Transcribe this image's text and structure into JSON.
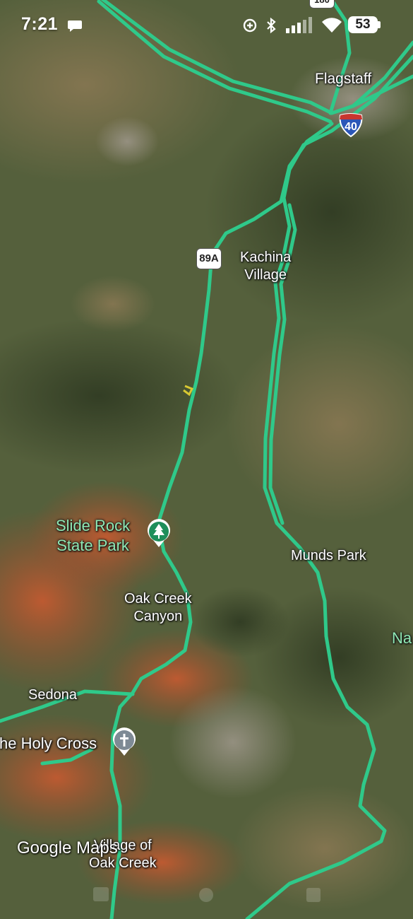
{
  "status_bar": {
    "time": "7:21",
    "battery": "53",
    "icons": [
      "chat-bubble-icon",
      "data-saver-icon",
      "bluetooth-icon",
      "signal-bars-icon",
      "wifi-icon",
      "battery-icon"
    ]
  },
  "map": {
    "route_color": "#2fc98a",
    "highway_shields": {
      "us_89a": "89A",
      "i_40": "40",
      "us_180": "180"
    },
    "labels": {
      "flagstaff": "Flagstaff",
      "kachina_village_line1": "Kachina",
      "kachina_village_line2": "Village",
      "slide_rock_line1": "Slide Rock",
      "slide_rock_line2": "State Park",
      "oak_creek_canyon_line1": "Oak Creek",
      "oak_creek_canyon_line2": "Canyon",
      "munds_park": "Munds Park",
      "sedona": "Sedona",
      "holy_cross": "he Holy Cross",
      "village_oak_creek_line1": "Village of",
      "village_oak_creek_line2": "Oak Creek",
      "national_forest_fragment": "Na"
    },
    "pois": [
      "tree-pin-icon",
      "cross-pin-icon"
    ]
  },
  "branding": {
    "google_maps": "Google Maps"
  }
}
